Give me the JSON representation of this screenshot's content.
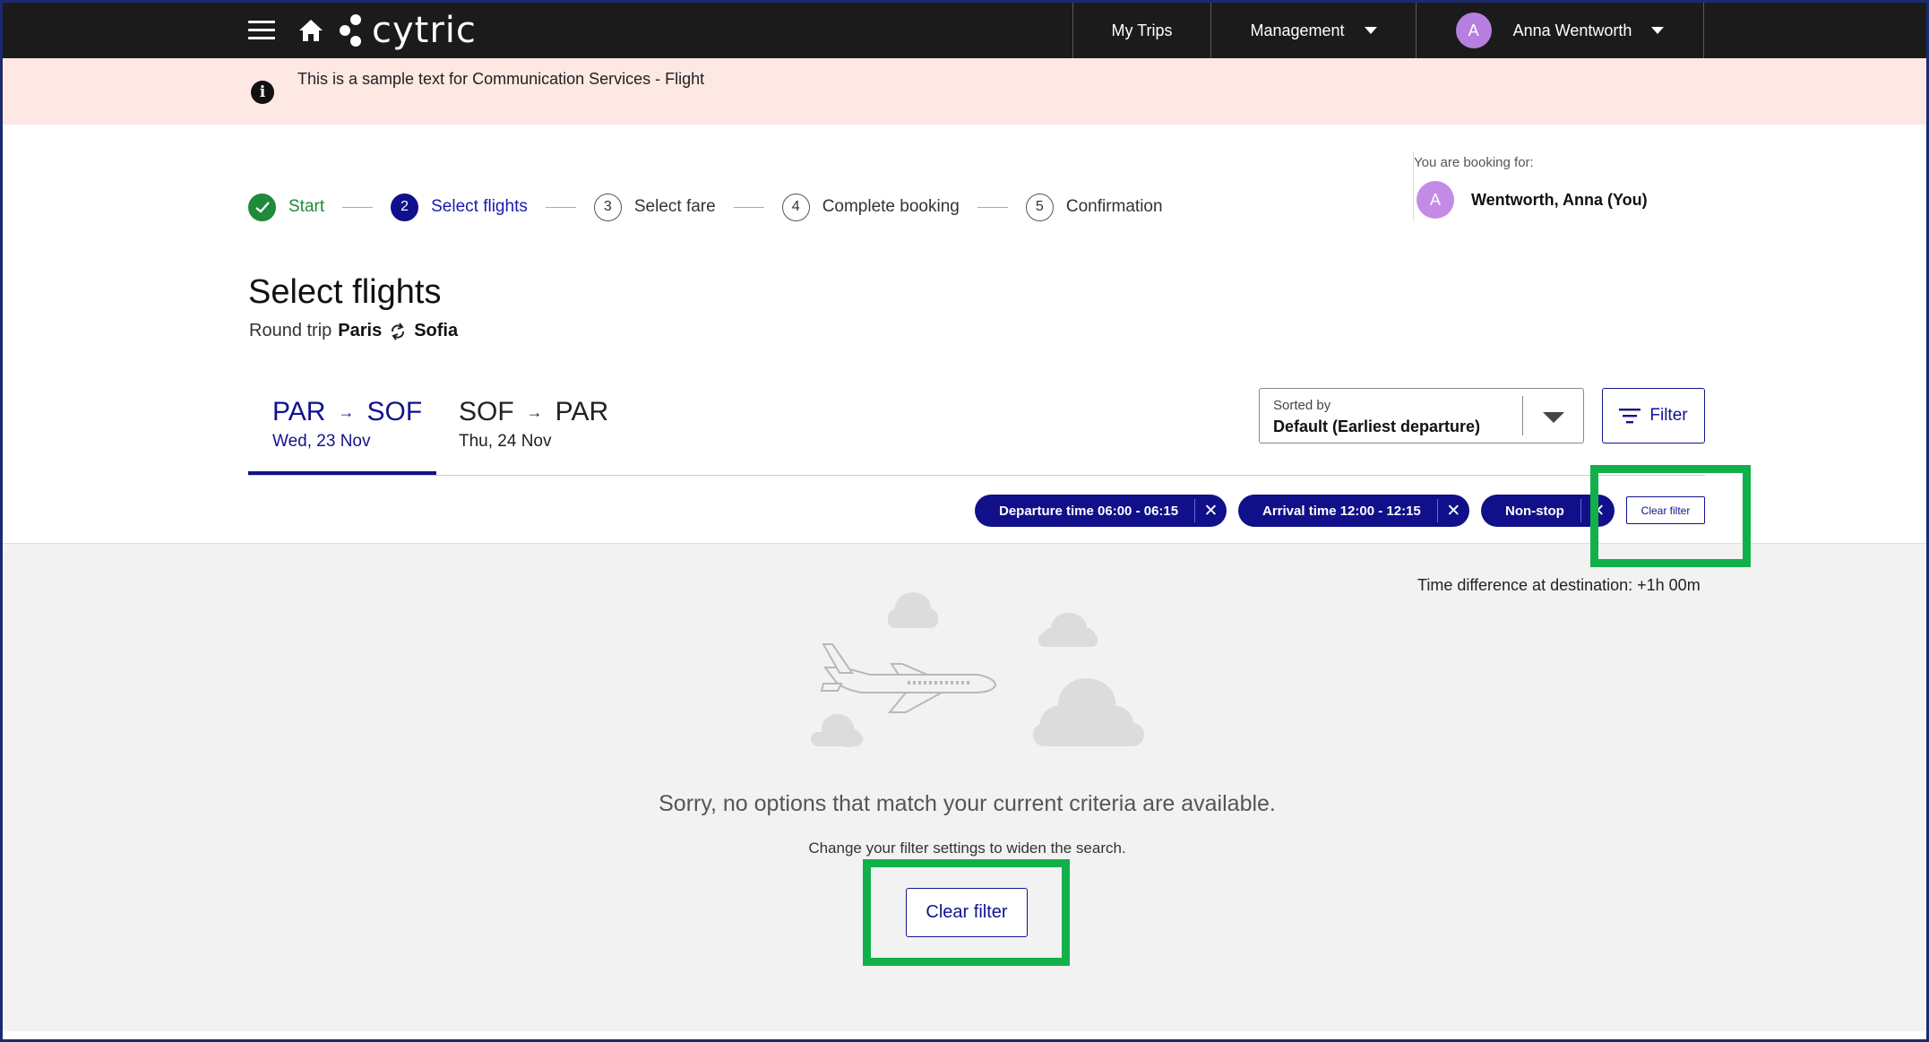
{
  "header": {
    "logo_text": "cytric",
    "nav": {
      "my_trips": "My Trips",
      "management": "Management",
      "user_initial": "A",
      "user_name": "Anna Wentworth"
    }
  },
  "banner": {
    "text": "This is a sample text for Communication Services - Flight",
    "icon": "info-icon"
  },
  "booking_for": {
    "label": "You are booking for:",
    "initial": "A",
    "name": "Wentworth, Anna (You)"
  },
  "stepper": {
    "steps": [
      {
        "number": "1",
        "label": "Start",
        "state": "done"
      },
      {
        "number": "2",
        "label": "Select flights",
        "state": "active"
      },
      {
        "number": "3",
        "label": "Select fare",
        "state": "pending"
      },
      {
        "number": "4",
        "label": "Complete booking",
        "state": "pending"
      },
      {
        "number": "5",
        "label": "Confirmation",
        "state": "pending"
      }
    ]
  },
  "page": {
    "title": "Select flights",
    "trip_type": "Round trip",
    "origin": "Paris",
    "destination": "Sofia"
  },
  "tabs": [
    {
      "from": "PAR",
      "to": "SOF",
      "date": "Wed, 23 Nov",
      "selected": true
    },
    {
      "from": "SOF",
      "to": "PAR",
      "date": "Thu, 24 Nov",
      "selected": false
    }
  ],
  "sort": {
    "label": "Sorted by",
    "value": "Default (Earliest departure)"
  },
  "filter_button": "Filter",
  "chips": [
    {
      "label": "Departure time 06:00 - 06:15"
    },
    {
      "label": "Arrival time 12:00 - 12:15"
    },
    {
      "label": "Non-stop"
    }
  ],
  "clear_filter_small": "Clear filter",
  "time_difference": "Time difference at destination: +1h 00m",
  "empty_state": {
    "message": "Sorry, no options that match your current criteria are available.",
    "hint": "Change your filter settings to widen the search.",
    "clear_button": "Clear filter"
  },
  "colors": {
    "brand_navy": "#10108a",
    "highlight_green": "#12b04a",
    "success_green": "#1e8a3a",
    "banner_bg": "#fde8e4"
  }
}
